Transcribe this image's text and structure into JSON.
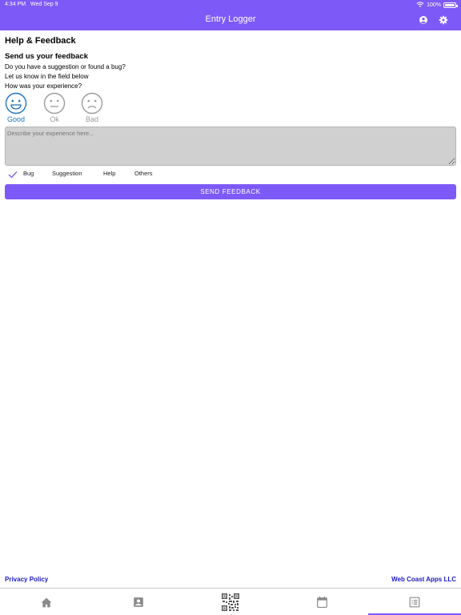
{
  "status_bar": {
    "time": "4:34 PM",
    "date": "Wed Sep 9",
    "battery": "100%"
  },
  "header": {
    "title": "Entry Logger",
    "icons": [
      "account-circle-icon",
      "gear-icon"
    ]
  },
  "page": {
    "title": "Help & Feedback",
    "section_title": "Send us your feedback",
    "lines": [
      "Do you have a suggestion or found a bug?",
      "Let us know in the field below",
      "How was your experience?"
    ]
  },
  "ratings": [
    {
      "label": "Good",
      "icon": "smiley-happy-icon",
      "selected": true,
      "color": "#1e73be"
    },
    {
      "label": "Ok",
      "icon": "smiley-neutral-icon",
      "selected": false,
      "color": "#9b9b9b"
    },
    {
      "label": "Bad",
      "icon": "smiley-sad-icon",
      "selected": false,
      "color": "#9b9b9b"
    }
  ],
  "feedback_input": {
    "placeholder": "Describe your experience here...",
    "value": ""
  },
  "categories": [
    {
      "label": "Bug",
      "checked": true
    },
    {
      "label": "Suggestion",
      "checked": false
    },
    {
      "label": "Help",
      "checked": false
    },
    {
      "label": "Others",
      "checked": false
    }
  ],
  "send_button": {
    "label": "SEND FEEDBACK"
  },
  "footer": {
    "privacy": "Privacy Policy",
    "company": "Web Coast Apps LLC"
  },
  "tabbar": {
    "items": [
      {
        "icon": "home-icon",
        "active": false
      },
      {
        "icon": "contact-card-icon",
        "active": false
      },
      {
        "icon": "qr-code-icon",
        "active": false
      },
      {
        "icon": "calendar-icon",
        "active": false
      },
      {
        "icon": "list-document-icon",
        "active": true
      }
    ]
  },
  "colors": {
    "accent": "#7d5af7",
    "link": "#1a1ac2",
    "selected_rating": "#1e73be"
  }
}
